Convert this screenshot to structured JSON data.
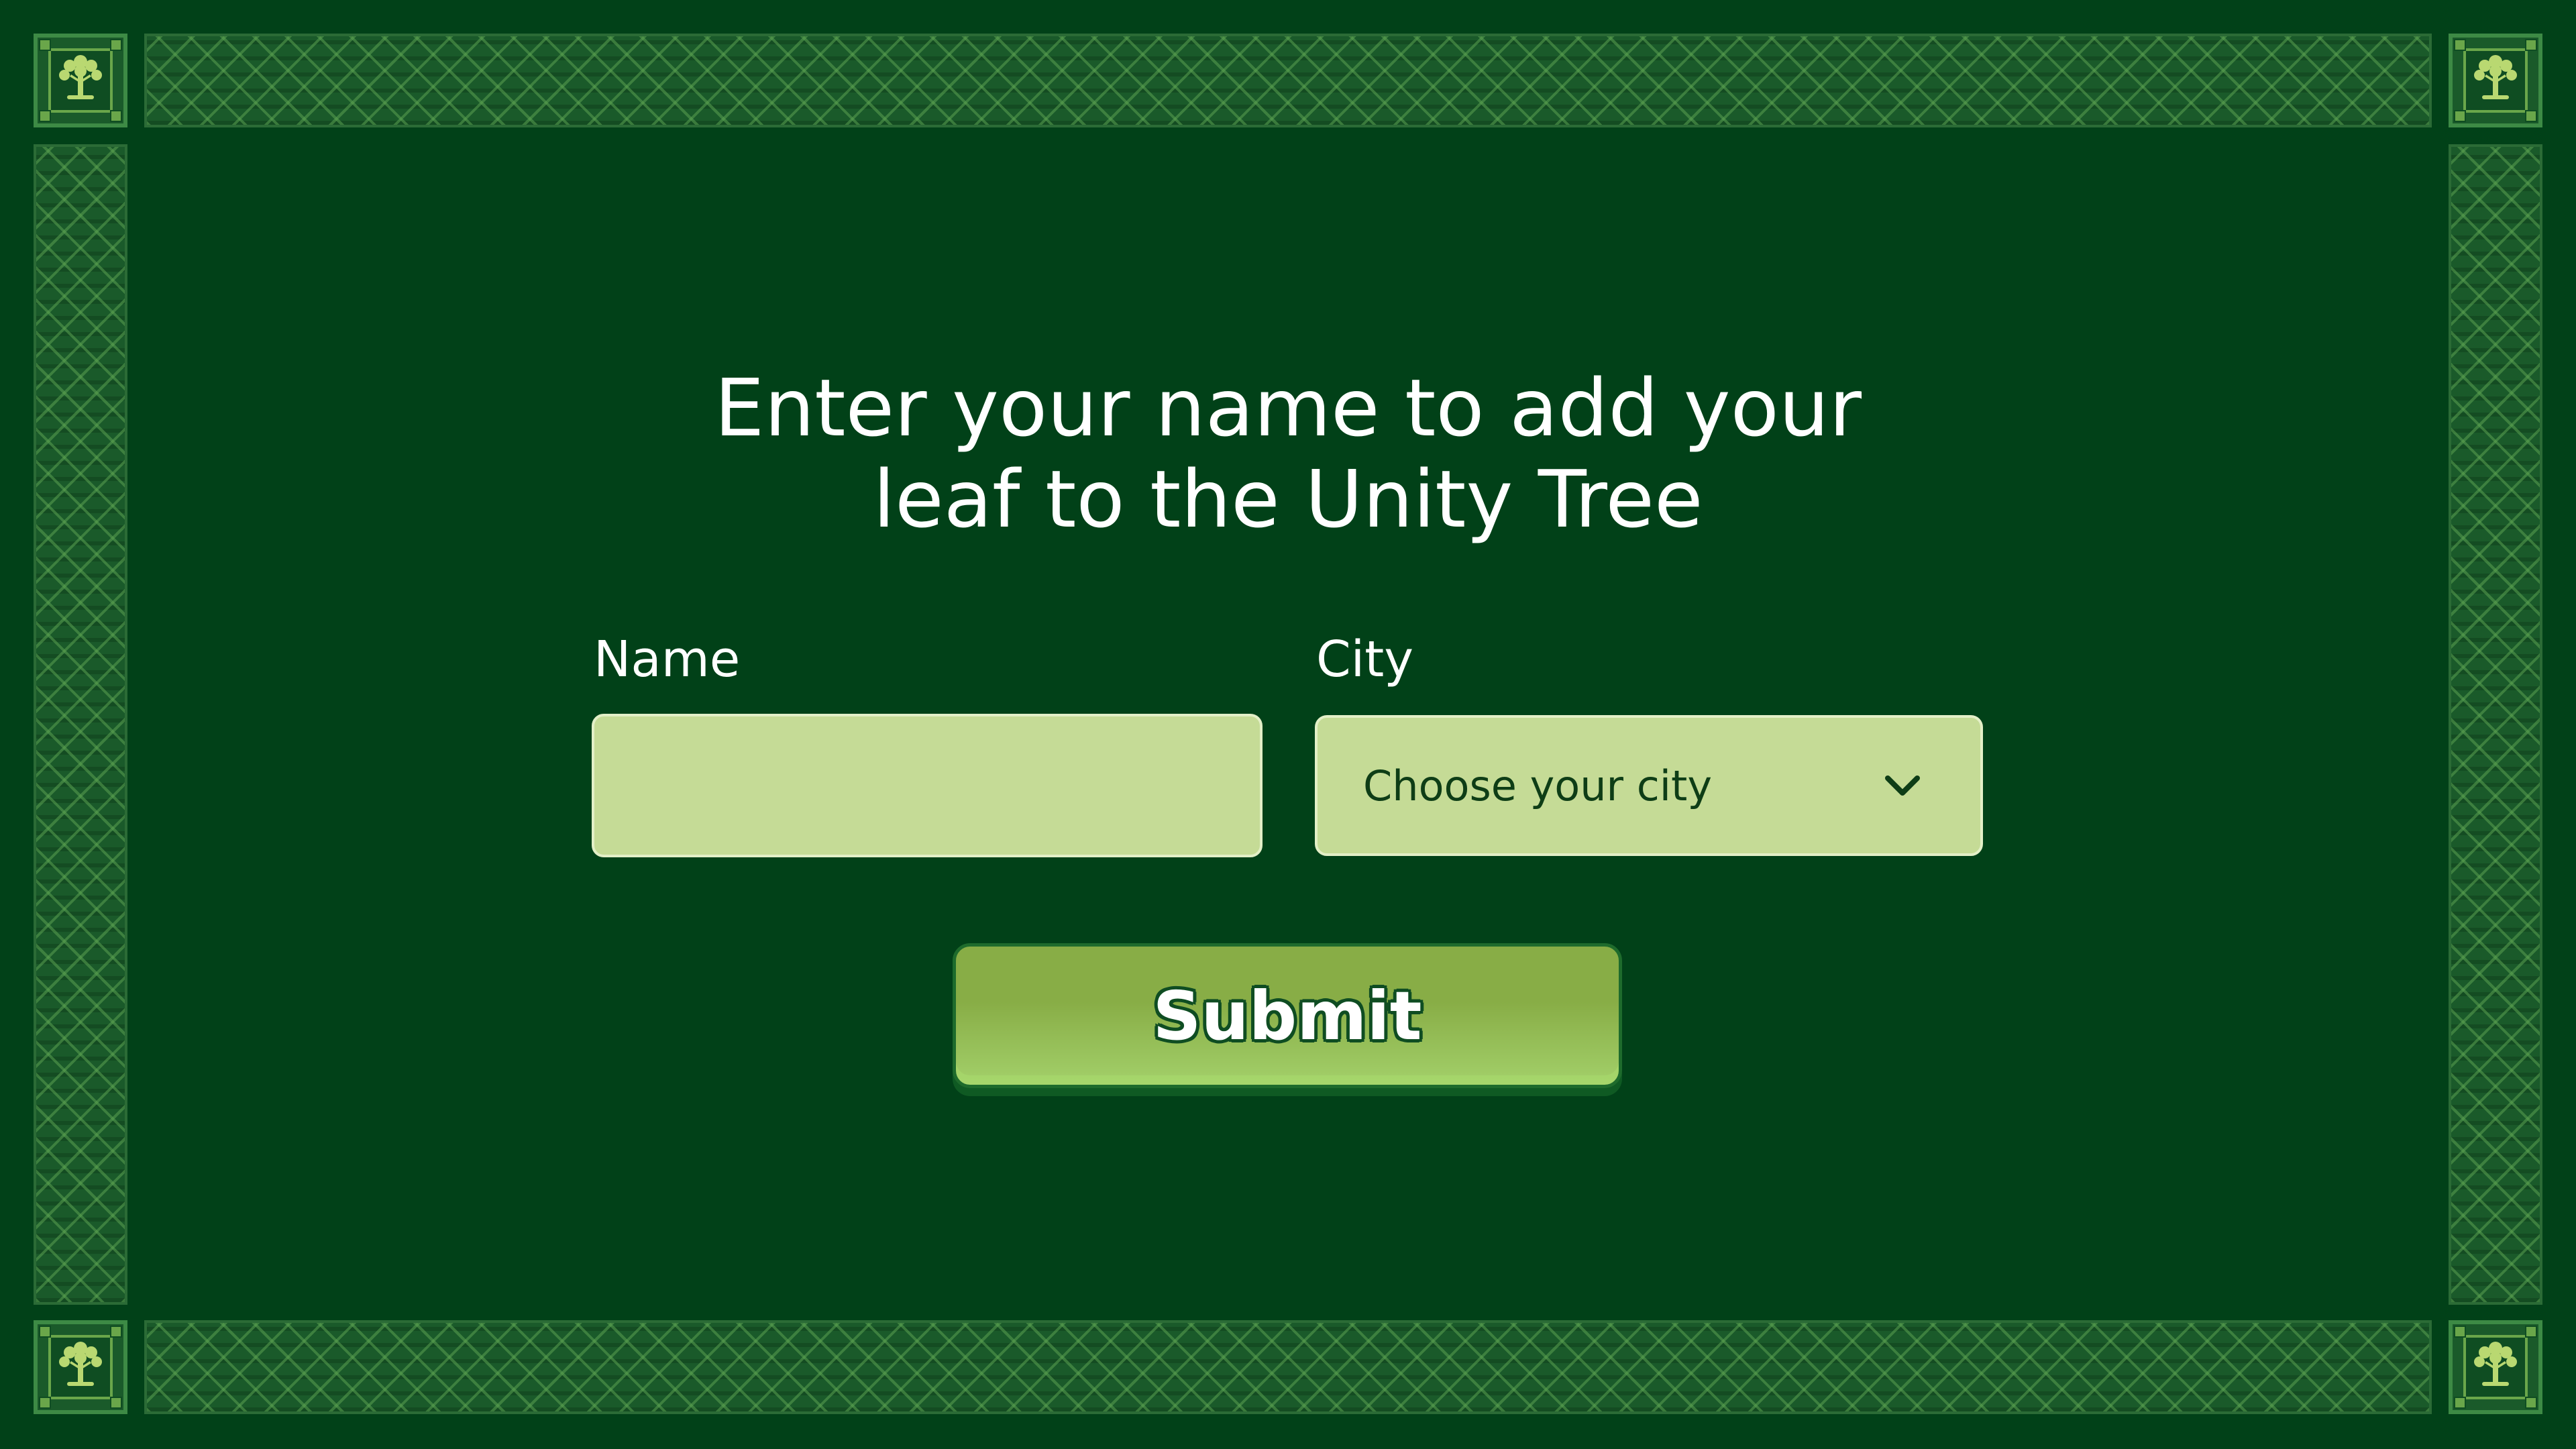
{
  "heading": {
    "line1": "Enter your name to add your",
    "line2": "leaf to the Unity Tree"
  },
  "form": {
    "name": {
      "label": "Name",
      "value": "",
      "placeholder": ""
    },
    "city": {
      "label": "City",
      "selected": "Choose your city"
    },
    "submit_label": "Submit"
  },
  "icons": {
    "corner": "tree-icon",
    "dropdown": "chevron-down-icon"
  },
  "colors": {
    "background": "#014118",
    "field": "#c5db96",
    "button": "#88ad46",
    "text": "#ffffff"
  }
}
